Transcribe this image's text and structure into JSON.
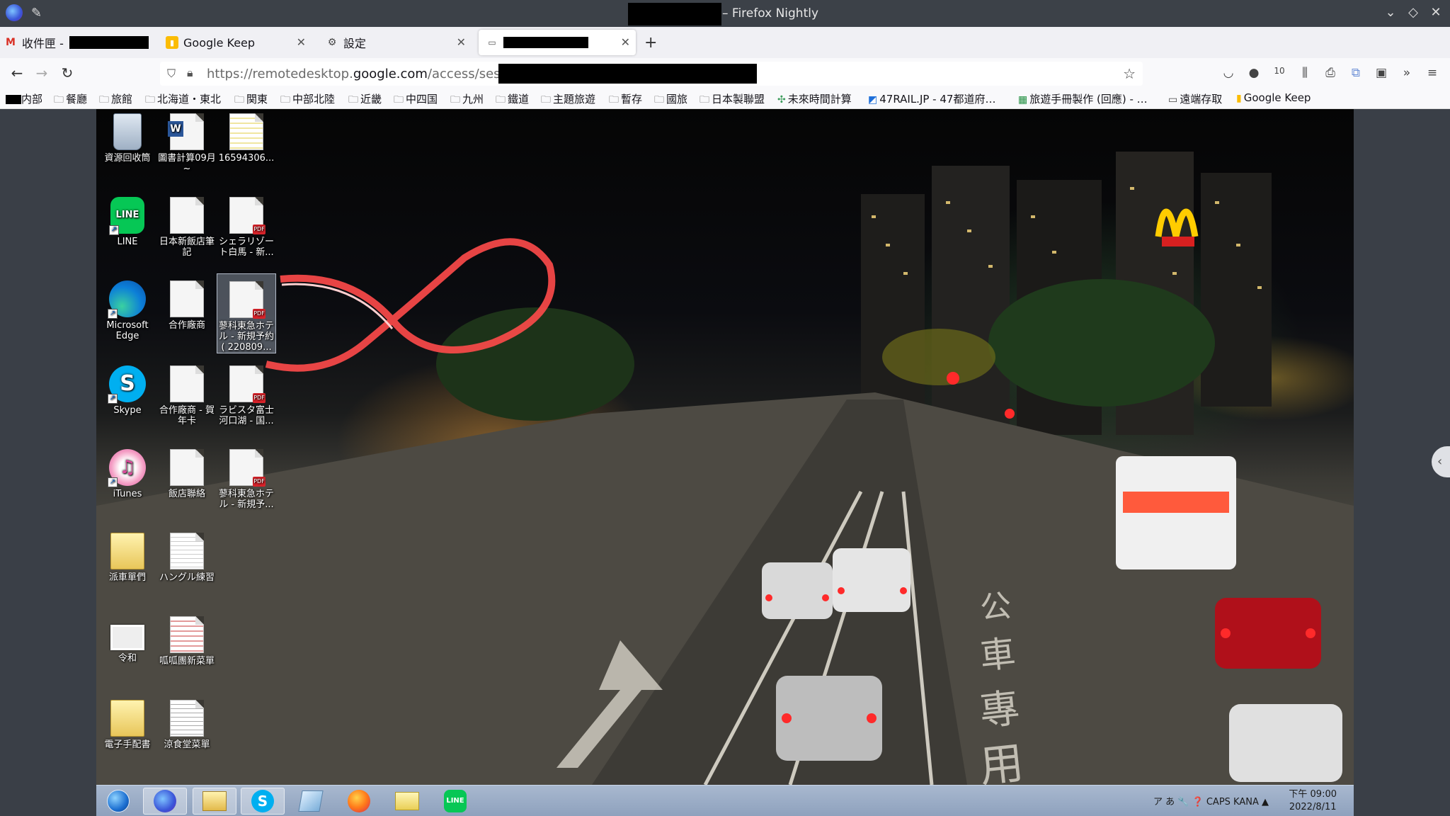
{
  "window": {
    "title": "– Firefox Nightly",
    "controls": [
      "chevron-down-icon",
      "restore-icon",
      "close-icon"
    ]
  },
  "tabs": [
    {
      "label": "收件匣 -",
      "icon": "gmail-icon"
    },
    {
      "label": "Google Keep",
      "icon": "google-keep-icon"
    },
    {
      "label": "設定",
      "icon": "gear-icon"
    },
    {
      "label": "",
      "icon": "remote-desktop-icon",
      "active": true
    }
  ],
  "navbar": {
    "url_prefix": "https://remotedesktop.",
    "url_domain": "google.com",
    "url_path": "/access/session/"
  },
  "bookmarks": [
    {
      "label": "内部",
      "icon": "redacted"
    },
    {
      "label": "餐廳",
      "icon": "folder-icon"
    },
    {
      "label": "旅館",
      "icon": "folder-icon"
    },
    {
      "label": "北海道・東北",
      "icon": "folder-icon"
    },
    {
      "label": "関東",
      "icon": "folder-icon"
    },
    {
      "label": "中部北陸",
      "icon": "folder-icon"
    },
    {
      "label": "近畿",
      "icon": "folder-icon"
    },
    {
      "label": "中四国",
      "icon": "folder-icon"
    },
    {
      "label": "九州",
      "icon": "folder-icon"
    },
    {
      "label": "鐵道",
      "icon": "folder-icon"
    },
    {
      "label": "主題旅遊",
      "icon": "folder-icon"
    },
    {
      "label": "暫存",
      "icon": "folder-icon"
    },
    {
      "label": "國旅",
      "icon": "folder-icon"
    },
    {
      "label": "日本製聯盟",
      "icon": "folder-icon"
    },
    {
      "label": "未來時間計算",
      "icon": "sparkle-icon"
    },
    {
      "label": "47RAIL.JP - 47都道府…",
      "icon": "rail-icon"
    },
    {
      "label": "旅遊手冊製作 (回應) - …",
      "icon": "sheets-icon"
    },
    {
      "label": "遠端存取",
      "icon": "remote-icon"
    },
    {
      "label": "Google Keep",
      "icon": "google-keep-icon"
    }
  ],
  "desktop_icons": [
    {
      "label": "資源回收筒",
      "kind": "recycle-bin"
    },
    {
      "label": "圖書計算09月~",
      "kind": "word"
    },
    {
      "label": "16594306...",
      "kind": "doc"
    },
    {
      "label": "LINE",
      "kind": "line"
    },
    {
      "label": "日本新飯店筆記",
      "kind": "doc"
    },
    {
      "label": "シェラリゾート白馬 - 新...",
      "kind": "pdf"
    },
    {
      "label": "Microsoft Edge",
      "kind": "edge"
    },
    {
      "label": "合作廠商",
      "kind": "doc"
    },
    {
      "label": "蓼科東急ホテル - 新規予約 ( 220809...",
      "kind": "pdf"
    },
    {
      "label": "Skype",
      "kind": "skype"
    },
    {
      "label": "合作廠商 - 賀年卡",
      "kind": "doc"
    },
    {
      "label": "ラビスタ富士河口湖 - 国...",
      "kind": "pdf"
    },
    {
      "label": "iTunes",
      "kind": "itunes"
    },
    {
      "label": "飯店聯絡",
      "kind": "doc"
    },
    {
      "label": "蓼科東急ホテル - 新規予...",
      "kind": "pdf"
    },
    {
      "label": "派車單們",
      "kind": "folder"
    },
    {
      "label": "ハングル練習",
      "kind": "doc"
    },
    {
      "label": "令和",
      "kind": "image"
    },
    {
      "label": "呱呱團新菜單",
      "kind": "doc"
    },
    {
      "label": "電子手配書",
      "kind": "folder"
    },
    {
      "label": "涼食堂菜單",
      "kind": "doc"
    }
  ],
  "taskbar": {
    "items": [
      "start-icon",
      "firefox-nightly-icon",
      "file-explorer-icon",
      "skype-icon",
      "documents-icon",
      "firefox-icon",
      "folder-icon",
      "line-icon"
    ],
    "tray_text": "ア あ 🔧 ❓ CAPS KANA ▲",
    "time": "下午 09:00",
    "date": "2022/8/11"
  }
}
